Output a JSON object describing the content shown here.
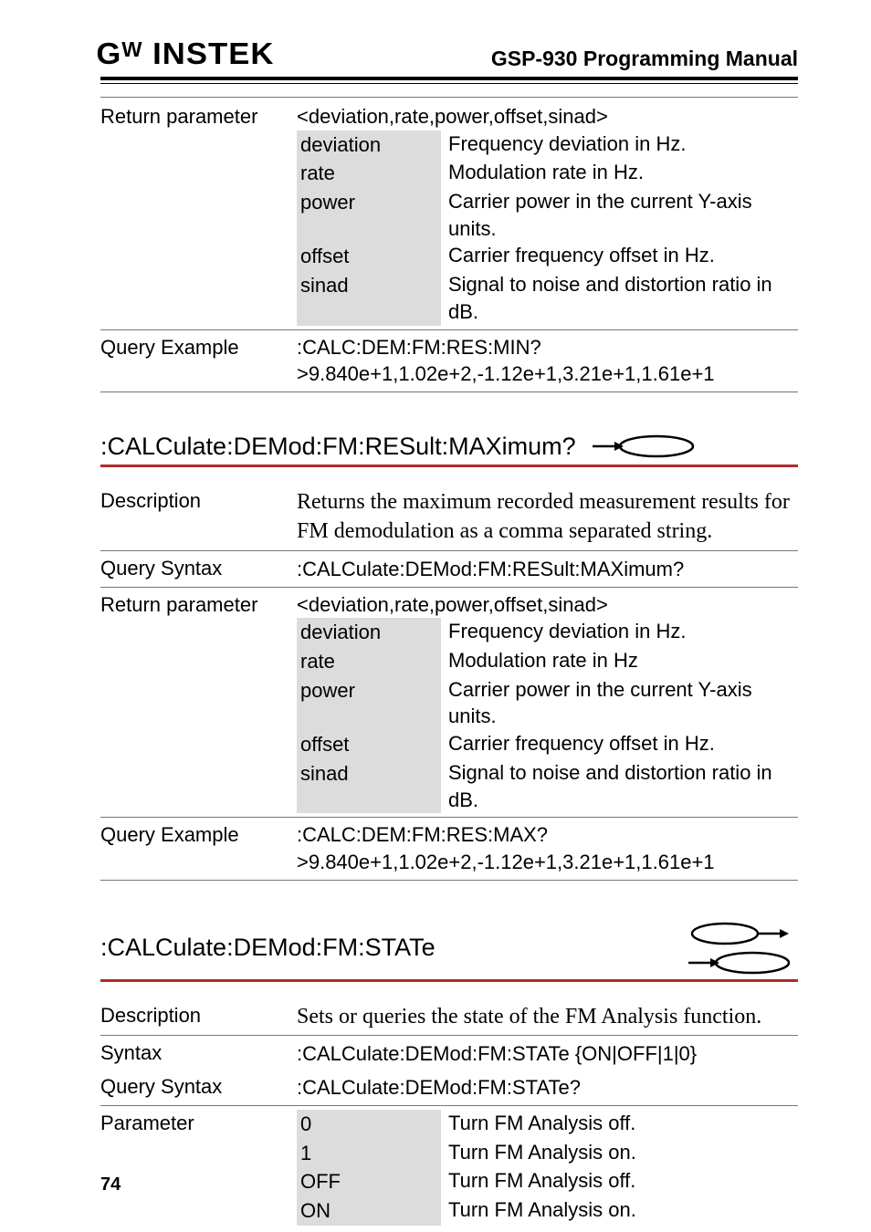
{
  "header": {
    "logo": "Gᵂ INSTEK",
    "title": "GSP-930 Programming Manual"
  },
  "top_block": {
    "return_label": "Return parameter",
    "return_head": "<deviation,rate,power,offset,sinad>",
    "kv": [
      {
        "k": "deviation",
        "d": "Frequency deviation in Hz."
      },
      {
        "k": "rate",
        "d": "Modulation rate in Hz."
      },
      {
        "k": "power",
        "d": "Carrier power in the current Y-axis units."
      },
      {
        "k": "offset",
        "d": "Carrier frequency offset in Hz."
      },
      {
        "k": "sinad",
        "d": "Signal to noise and distortion ratio in dB."
      }
    ],
    "example_label": "Query Example",
    "example_lines": [
      ":CALC:DEM:FM:RES:MIN?",
      ">9.840e+1,1.02e+2,-1.12e+1,3.21e+1,1.61e+1"
    ]
  },
  "sec1": {
    "title": ":CALCulate:DEMod:FM:RESult:MAXimum?",
    "desc_label": "Description",
    "desc": "Returns the maximum recorded measurement results for FM demodulation as a comma separated string.",
    "qsyn_label": "Query Syntax",
    "qsyn": ":CALCulate:DEMod:FM:RESult:MAXimum?",
    "return_label": "Return parameter",
    "return_head": "<deviation,rate,power,offset,sinad>",
    "kv": [
      {
        "k": "deviation",
        "d": "Frequency deviation in Hz."
      },
      {
        "k": "rate",
        "d": "Modulation rate in Hz"
      },
      {
        "k": "power",
        "d": "Carrier power in the current Y-axis units."
      },
      {
        "k": "offset",
        "d": "Carrier frequency offset in Hz."
      },
      {
        "k": "sinad",
        "d": "Signal to noise and distortion ratio in dB."
      }
    ],
    "example_label": "Query Example",
    "example_lines": [
      ":CALC:DEM:FM:RES:MAX?",
      ">9.840e+1,1.02e+2,-1.12e+1,3.21e+1,1.61e+1"
    ]
  },
  "sec2": {
    "title": ":CALCulate:DEMod:FM:STATe",
    "desc_label": "Description",
    "desc": "Sets or queries the state of the FM Analysis function.",
    "syn_label": "Syntax",
    "syn": ":CALCulate:DEMod:FM:STATe {ON|OFF|1|0}",
    "qsyn_label": "Query Syntax",
    "qsyn": ":CALCulate:DEMod:FM:STATe?",
    "param_label": "Parameter",
    "kv": [
      {
        "k": "0",
        "d": "Turn FM Analysis off."
      },
      {
        "k": "1",
        "d": "Turn FM Analysis on."
      },
      {
        "k": "OFF",
        "d": "Turn FM Analysis off."
      },
      {
        "k": "ON",
        "d": "Turn FM Analysis on."
      }
    ]
  },
  "footer": {
    "page": "74"
  }
}
